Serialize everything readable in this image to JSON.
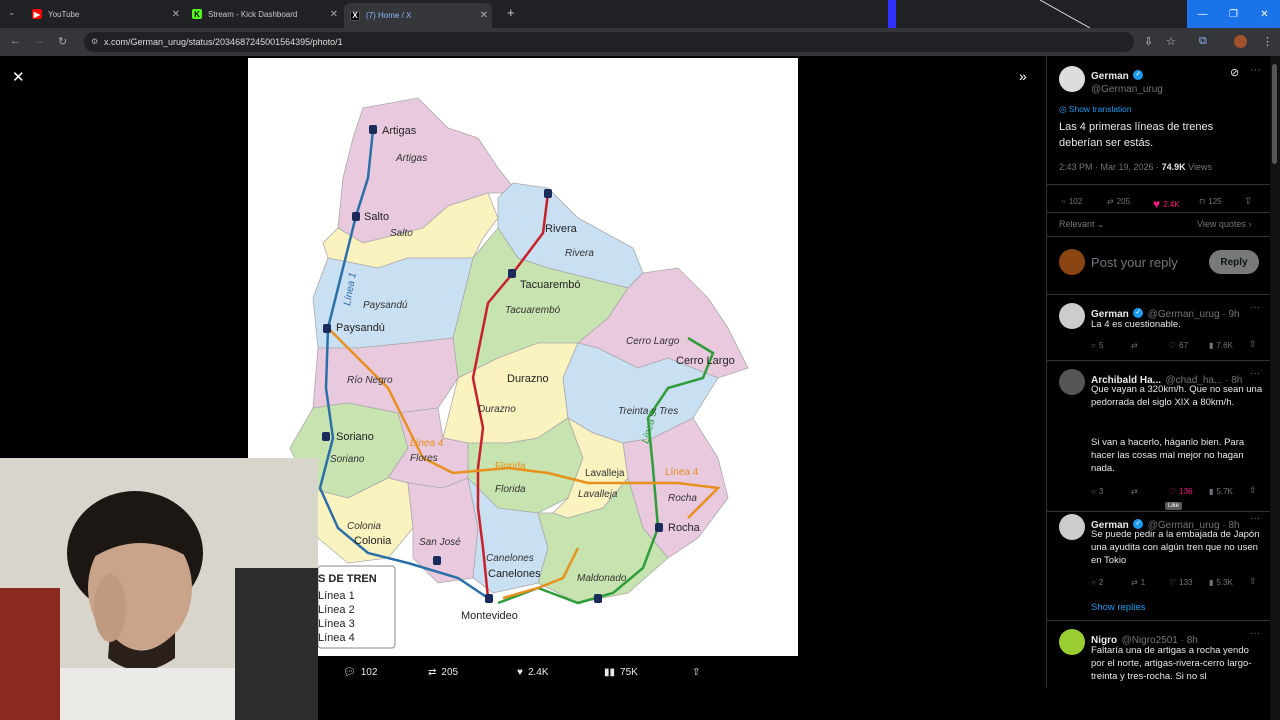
{
  "browser": {
    "tabs": [
      {
        "title": "YouTube",
        "icon": "youtube-icon",
        "color": "#ff0000"
      },
      {
        "title": "Stream - Kick Dashboard",
        "icon": "kick-icon",
        "color": "#53fc18"
      },
      {
        "title": "(7) Home / X",
        "icon": "x-icon",
        "color": "#ffffff"
      }
    ],
    "url": "x.com/German_urug/status/2034687245001564395/photo/1"
  },
  "map": {
    "places": [
      "Artigas",
      "Salto",
      "Rivera",
      "Tacuarembó",
      "Paysandú",
      "Cerro Largo",
      "Durazno",
      "Soriano",
      "Flores",
      "Florida",
      "Lavalleja",
      "Treinta y Tres",
      "Rocha",
      "Colonia",
      "San José",
      "Canelones",
      "Maldonado",
      "Montevideo",
      "Río Negro"
    ],
    "city_labels": {
      "artigas": "Artigas",
      "salto": "Salto",
      "rivera": "Rivera",
      "tacuarembo": "Tacuarembó",
      "paysandu": "Paysandú",
      "cerro_largo": "Cerro Largo",
      "durazno": "Durazno",
      "soriano": "Soriano",
      "rocha": "Rocha",
      "colonia": "Colonia",
      "canelones": "Canelones",
      "montevideo": "Montevideo"
    },
    "dept_labels": {
      "artigas": "Artigas",
      "salto": "Salto",
      "rivera": "Rivera",
      "tacuarembo": "Tacuarembó",
      "paysandu": "Paysandú",
      "rio_negro": "Río Negro",
      "cerro_largo": "Cerro Largo",
      "durazno": "Durazno",
      "treinta": "Treinta y Tres",
      "soriano": "Soriano",
      "flores": "Flores",
      "florida_city": "Florida",
      "florida": "Florida",
      "lavalleja_city": "Lavalleja",
      "lavalleja": "Lavalleja",
      "rocha": "Rocha",
      "colonia": "Colonia",
      "san_jose": "San José",
      "canelones": "Canelones",
      "maldonado": "Maldonado"
    },
    "line_labels": {
      "l1": "Línea 1",
      "l3": "Línea 3",
      "l4a": "Línea 4",
      "l4b": "Línea 4"
    },
    "legend_title": "S DE TREN",
    "legend": [
      "Línea 1",
      "Línea 2",
      "Línea 3",
      "Línea 4"
    ],
    "colors": {
      "line1": "#2b6fa8",
      "line2": "#c8202a",
      "line3": "#2f9e3a",
      "line4": "#e8901c"
    }
  },
  "photo_actions": {
    "replies": "102",
    "reposts": "205",
    "likes": "2.4K",
    "views": "75K"
  },
  "tweet": {
    "name": "German",
    "handle": "@German_urug",
    "show_translation": "Show translation",
    "text": "Las 4 primeras líneas de trenes deberían ser estás.",
    "time": "2:43 PM · Mar 19, 2026 ·",
    "views_count": "74.9K",
    "views_label": "Views",
    "replies": "102",
    "reposts": "205",
    "likes": "2.4K",
    "bookmarks": "125",
    "relevant": "Relevant",
    "view_quotes": "View quotes",
    "reply_placeholder": "Post your reply",
    "reply_button": "Reply"
  },
  "replies": [
    {
      "name": "German",
      "handle": "@German_urug · 9h",
      "text": "La 4 es cuestionable.",
      "replies": "5",
      "reposts": "",
      "likes": "67",
      "views": "7.6K"
    },
    {
      "name": "Archibald Ha...",
      "handle": "@chad_ha... · 8h",
      "text": "Que vayan a 320km/h. Que no sean una pedorrada del siglo XIX a 80km/h.",
      "text2": "Si van a hacerlo, háganlo bien. Para hacer las cosas mal mejor no hagan nada.",
      "replies": "3",
      "reposts": "",
      "likes": "136",
      "views": "5.7K",
      "tooltip": "Like"
    },
    {
      "name": "German",
      "handle": "@German_urug · 8h",
      "text": "Se puede pedir a la embajada de Japón una ayudita con algún tren que no usen en Tokio",
      "replies": "2",
      "reposts": "1",
      "likes": "133",
      "views": "5.3K",
      "show_replies": "Show replies"
    },
    {
      "name": "Nigro",
      "handle": "@Nigro2501 · 8h",
      "text": "Faltaría una de artigas a rocha yendo por el norte, artigas-rivera-cerro largo-treinta y tres-rocha. Si no sl"
    }
  ]
}
